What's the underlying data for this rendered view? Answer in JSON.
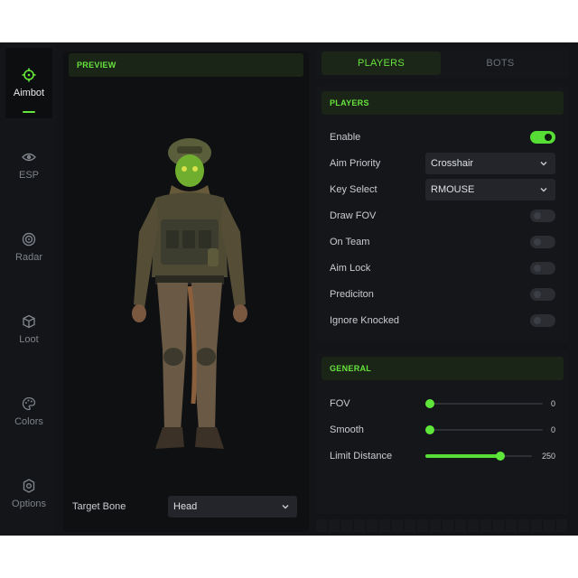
{
  "sidebar": {
    "items": [
      {
        "label": "Aimbot",
        "icon": "crosshair-icon",
        "active": true
      },
      {
        "label": "ESP",
        "icon": "eye-icon"
      },
      {
        "label": "Radar",
        "icon": "radar-icon"
      },
      {
        "label": "Loot",
        "icon": "cube-icon"
      },
      {
        "label": "Colors",
        "icon": "palette-icon"
      },
      {
        "label": "Options",
        "icon": "gear-icon"
      }
    ]
  },
  "preview": {
    "title": "PREVIEW",
    "target_bone_label": "Target Bone",
    "target_bone_value": "Head"
  },
  "tabs": {
    "players": "PLAYERS",
    "bots": "BOTS"
  },
  "players_panel": {
    "title": "PLAYERS",
    "enable_label": "Enable",
    "enable_on": true,
    "aim_priority_label": "Aim Priority",
    "aim_priority_value": "Crosshair",
    "key_select_label": "Key Select",
    "key_select_value": "RMOUSE",
    "draw_fov_label": "Draw FOV",
    "draw_fov_on": false,
    "on_team_label": "On Team",
    "on_team_on": false,
    "aim_lock_label": "Aim Lock",
    "aim_lock_on": false,
    "prediction_label": "Prediciton",
    "prediction_on": false,
    "ignore_knocked_label": "Ignore Knocked",
    "ignore_knocked_on": false
  },
  "general_panel": {
    "title": "GENERAL",
    "fov_label": "FOV",
    "fov_value": "0",
    "fov_fraction": 0.0,
    "smooth_label": "Smooth",
    "smooth_value": "0",
    "smooth_fraction": 0.0,
    "limit_distance_label": "Limit Distance",
    "limit_distance_value": "250",
    "limit_distance_fraction": 0.7
  },
  "colors": {
    "accent": "#63e63a",
    "panel": "#151619",
    "background": "#131417"
  }
}
